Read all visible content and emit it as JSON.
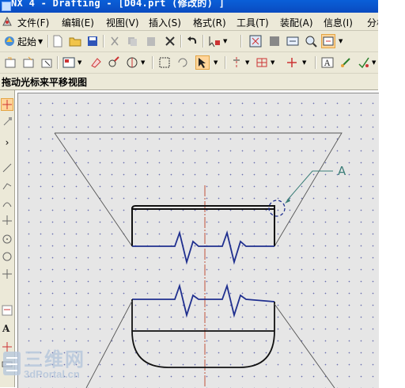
{
  "window": {
    "title": "NX 4 - Drafting - [D04.prt (修改的) ]"
  },
  "menu": [
    "文件(F)",
    "编辑(E)",
    "视图(V)",
    "插入(S)",
    "格式(R)",
    "工具(T)",
    "装配(A)",
    "信息(I)",
    "分析"
  ],
  "toolbar": {
    "start_label": "起始"
  },
  "status": {
    "prompt": "拖动光标来平移视图"
  },
  "drawing": {
    "callout_label": "A",
    "accent": "#1f2f8f",
    "callout_color": "#3b7d78"
  },
  "watermark": {
    "big": "三维网",
    "small": "3dPortal.cn"
  }
}
